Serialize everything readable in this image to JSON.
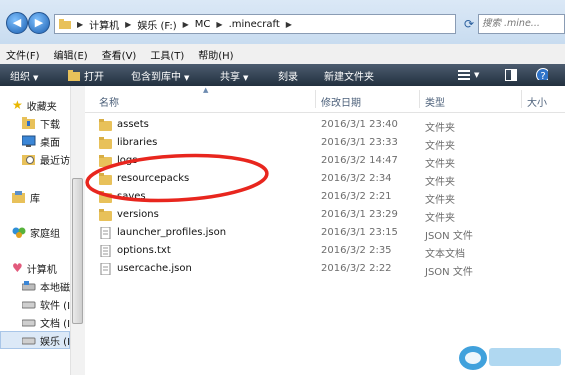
{
  "address": {
    "crumbs": [
      "计算机",
      "娱乐 (F:)",
      "MC",
      ".minecraft"
    ],
    "search_placeholder": "搜索 .mine..."
  },
  "menubar": [
    "文件(F)",
    "编辑(E)",
    "查看(V)",
    "工具(T)",
    "帮助(H)"
  ],
  "toolbar": {
    "organize": "组织",
    "open": "打开",
    "include": "包含到库中",
    "share": "共享",
    "burn": "刻录",
    "new_folder": "新建文件夹"
  },
  "sidebar": {
    "favorites": "收藏夹",
    "downloads": "下载",
    "desktop": "桌面",
    "recent": "最近访",
    "libraries": "库",
    "homegroup": "家庭组",
    "computer": "计算机",
    "local_disk": "本地磁",
    "software": "软件 (I",
    "documents": "文档 (I",
    "entertainment": "娱乐 (I"
  },
  "columns": {
    "name": "名称",
    "modified": "修改日期",
    "type": "类型",
    "size": "大小"
  },
  "files": [
    {
      "name": "assets",
      "date": "2016/3/1 23:40",
      "type": "文件夹",
      "icon": "folder-icon"
    },
    {
      "name": "libraries",
      "date": "2016/3/1 23:33",
      "type": "文件夹",
      "icon": "folder-icon"
    },
    {
      "name": "logs",
      "date": "2016/3/2 14:47",
      "type": "文件夹",
      "icon": "folder-icon"
    },
    {
      "name": "resourcepacks",
      "date": "2016/3/2 2:34",
      "type": "文件夹",
      "icon": "folder-icon"
    },
    {
      "name": "saves",
      "date": "2016/3/2 2:21",
      "type": "文件夹",
      "icon": "folder-icon"
    },
    {
      "name": "versions",
      "date": "2016/3/1 23:29",
      "type": "文件夹",
      "icon": "folder-icon"
    },
    {
      "name": "launcher_profiles.json",
      "date": "2016/3/1 23:15",
      "type": "JSON 文件",
      "icon": "json-file-icon"
    },
    {
      "name": "options.txt",
      "date": "2016/3/2 2:35",
      "type": "文本文档",
      "icon": "text-file-icon"
    },
    {
      "name": "usercache.json",
      "date": "2016/3/2 2:22",
      "type": "JSON 文件",
      "icon": "json-file-icon"
    }
  ],
  "colors": {
    "highlight_circle": "#e8261e",
    "toolbar_dark": "#22303f",
    "folder": "#e8c15a"
  }
}
